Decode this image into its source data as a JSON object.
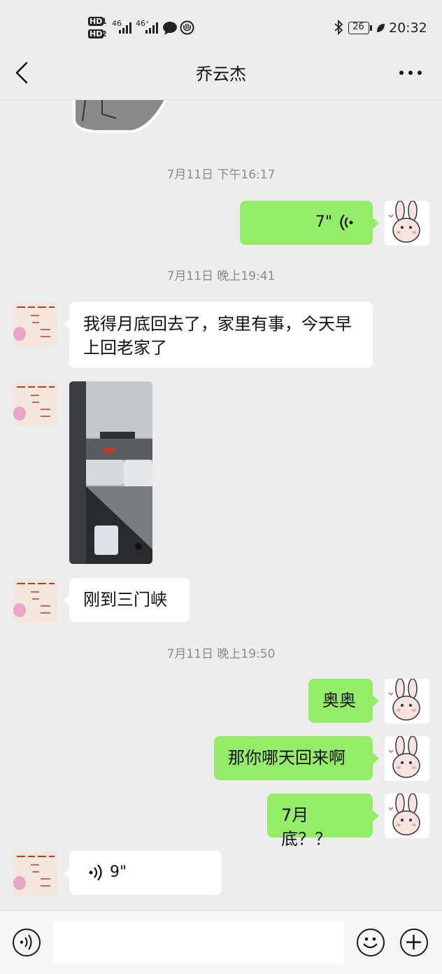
{
  "status_bar": {
    "hd1": "HD",
    "sim1": "1",
    "hd2": "HD",
    "sim2": "2",
    "net1": "46",
    "net2": "46⁺",
    "battery": "26",
    "time": "20:32"
  },
  "header": {
    "title": "乔云杰",
    "back_icon": "chevron-left-icon",
    "more_icon": "more-dots-icon"
  },
  "messages": {
    "ts1": "7月11日 下午16:17",
    "voice_sent_duration": "7\"",
    "ts2": "7月11日 晚上19:41",
    "msg_recv_1": "我得月底回去了，家里有事，今天早上回老家了",
    "msg_recv_2": "刚到三门峡",
    "ts3": "7月11日 晚上19:50",
    "msg_sent_1": "奥奥",
    "msg_sent_2": "那你哪天回来啊",
    "msg_sent_3": "7月底？？",
    "voice_recv_duration": "9\""
  },
  "input_bar": {
    "voice_icon": "voice-mode-icon",
    "emoji_icon": "emoji-icon",
    "plus_icon": "plus-icon",
    "text_value": ""
  },
  "colors": {
    "sent_bubble": "#95ec69",
    "recv_bubble": "#ffffff",
    "background": "#ededed"
  }
}
